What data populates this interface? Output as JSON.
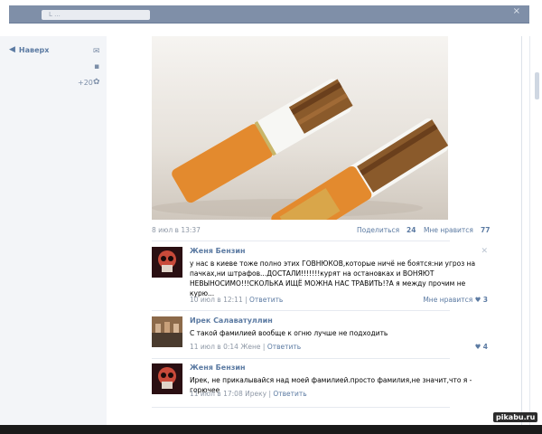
{
  "topbar": {
    "search_placeholder": "L  ..."
  },
  "left": {
    "up_label": "Наверх",
    "count_label": "+20"
  },
  "post": {
    "date": "8 июл в 13:37",
    "share_label": "Поделиться",
    "share_count": "24",
    "like_label": "Мне нравится",
    "like_count": "77"
  },
  "comments": [
    {
      "author": "Женя Бензин",
      "text": "у нас в киеве тоже полно этих ГОВНЮКОВ,которые ничё не боятся:ни угроз на пачках,ни штрафов...ДОСТАЛИ!!!!!!!курят на остановках и ВОНЯЮТ НЕВЫНОСИМО!!!СКОЛЬКА ИЩЁ МОЖНА НАС ТРАВИТЬ!?А я между прочим не курю...",
      "date": "10 июл в 12:11",
      "reply": "Ответить",
      "like_label": "Мне нравится",
      "like_count": "3"
    },
    {
      "author": "Ирек Салаватуллин",
      "text": "С такой фамилией вообще к огню лучше не подходить",
      "date": "11 июл в 0:14 Жене",
      "reply": "Ответить",
      "like_count": "4"
    },
    {
      "author": "Женя Бензин",
      "text": "Ирек, не прикалывайся над моей фамилией.просто фамилия,не значит,что я - горючее",
      "date": "11 июл в 17:08 Иреку",
      "reply": "Ответить"
    }
  ],
  "watermark": "pikabu.ru",
  "colors": {
    "link": "#5b7aa2",
    "muted": "#8d97a5",
    "topbar": "#7f8fa8"
  }
}
